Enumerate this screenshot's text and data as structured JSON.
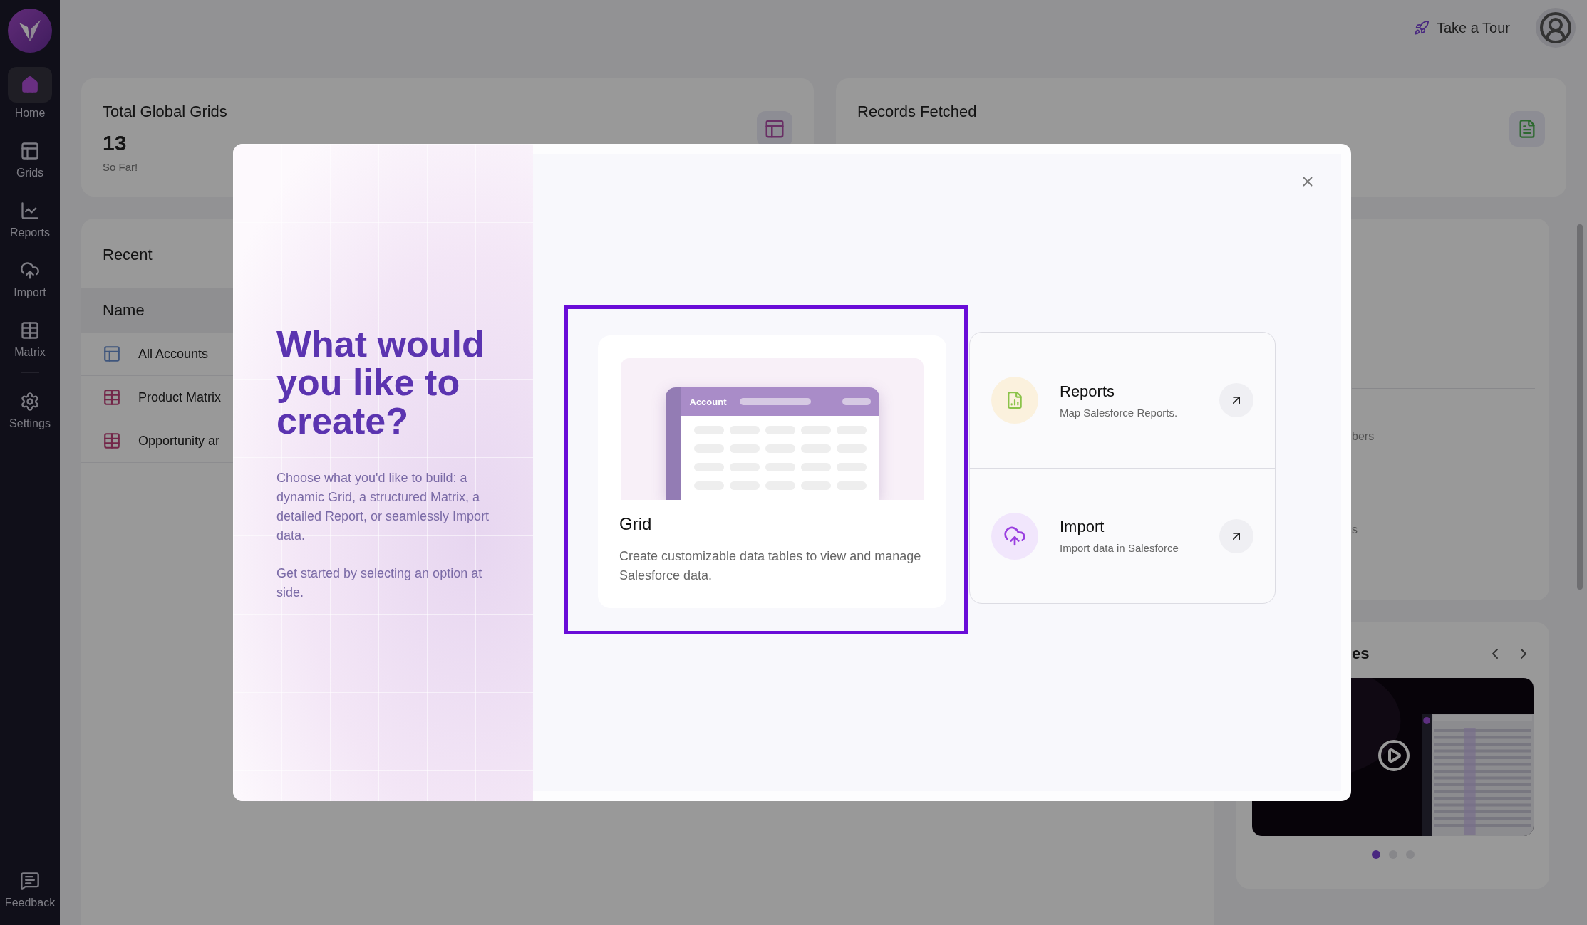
{
  "sidebar": {
    "items": [
      {
        "label": "Home",
        "kind": "home",
        "selected": true
      },
      {
        "label": "Grids",
        "kind": "grids",
        "selected": false
      },
      {
        "label": "Reports",
        "kind": "reports",
        "selected": false
      },
      {
        "label": "Import",
        "kind": "import",
        "selected": false
      },
      {
        "label": "Matrix",
        "kind": "matrix",
        "selected": false
      },
      {
        "label": "Settings",
        "kind": "settings",
        "selected": false
      }
    ],
    "feedback": "Feedback"
  },
  "header": {
    "tour": "Take a Tour"
  },
  "stats": [
    {
      "title": "Total Global Grids",
      "value": "13",
      "note": "So Far!",
      "kind": "grid"
    },
    {
      "title": "Records Fetched",
      "kind": "doc"
    }
  ],
  "recent": {
    "title": "Recent",
    "column": "Name",
    "rows": [
      {
        "name": "All Accounts",
        "kind": "grid"
      },
      {
        "name": "Product Matrix",
        "kind": "matrix"
      },
      {
        "name": "Opportunity ar",
        "kind": "matrix"
      }
    ]
  },
  "side_panel": {
    "fragments": [
      "bers",
      "s"
    ]
  },
  "videos": {
    "title": "es",
    "slides": [
      {
        "selected": true
      },
      {
        "selected": false
      },
      {
        "selected": false
      }
    ]
  },
  "modal": {
    "heading": "What would you like to create?",
    "paragraphs": [
      "Choose what you'd like to build: a dynamic Grid, a structured Matrix, a detailed Report, or seamlessly Import data.",
      "Get started by selecting an option at side."
    ],
    "options": [
      {
        "kind": "grid",
        "title": "Grid",
        "description": "Create customizable data tables to view and manage Salesforce data.",
        "preview_label": "Account",
        "selected": true
      },
      {
        "kind": "reports",
        "title": "Reports",
        "description": "Map Salesforce Reports.",
        "selected": false
      },
      {
        "kind": "import",
        "title": "Import",
        "description": "Import data in Salesforce",
        "selected": false
      }
    ]
  }
}
